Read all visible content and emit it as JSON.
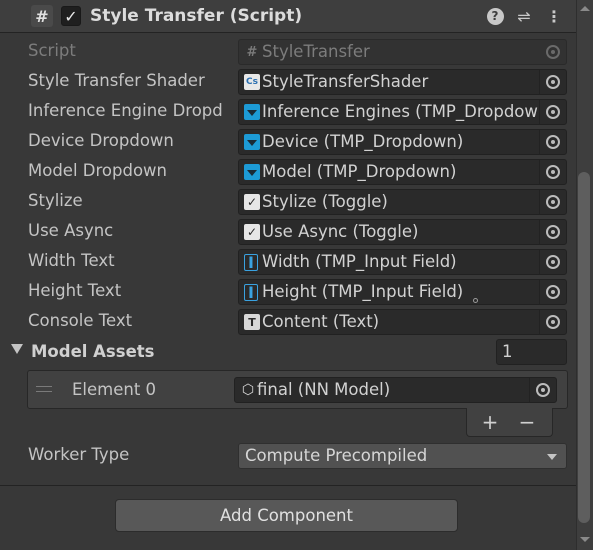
{
  "header": {
    "title": "Style Transfer (Script)",
    "enabled": true,
    "component_icon": "hash-script-icon",
    "buttons": [
      "help-icon",
      "presets-icon",
      "more-icon"
    ]
  },
  "fields": [
    {
      "label": "Script",
      "value": "StyleTransfer",
      "icon": "script-icon",
      "disabled": true
    },
    {
      "label": "Style Transfer Shader",
      "value": "StyleTransferShader",
      "icon": "compute-shader-icon",
      "icon_text": "Cs"
    },
    {
      "label": "Inference Engine Dropd",
      "value": "Inference Engines (TMP_Dropdown)",
      "icon": "dropdown-icon"
    },
    {
      "label": "Device Dropdown",
      "value": "Device (TMP_Dropdown)",
      "icon": "dropdown-icon"
    },
    {
      "label": "Model Dropdown",
      "value": "Model (TMP_Dropdown)",
      "icon": "dropdown-icon"
    },
    {
      "label": "Stylize",
      "value": "Stylize (Toggle)",
      "icon": "toggle-icon"
    },
    {
      "label": "Use Async",
      "value": "Use Async (Toggle)",
      "icon": "toggle-icon"
    },
    {
      "label": "Width Text",
      "value": "Width (TMP_Input Field)",
      "icon": "input-field-icon"
    },
    {
      "label": "Height Text",
      "value": "Height (TMP_Input Field)",
      "icon": "input-field-icon"
    },
    {
      "label": "Console Text",
      "value": "Content (Text)",
      "icon": "text-icon",
      "icon_text": "T"
    }
  ],
  "model_assets": {
    "label": "Model Assets",
    "count": "1",
    "elements": [
      {
        "label": "Element 0",
        "value": "final (NN Model)",
        "icon": "nn-model-icon"
      }
    ],
    "add_symbol": "+",
    "remove_symbol": "−"
  },
  "worker_type": {
    "label": "Worker Type",
    "value": "Compute Precompiled"
  },
  "add_component_label": "Add Component",
  "colors": {
    "background": "#383838",
    "field_bg": "#2a2a2a",
    "dropdown_icon": "#1d9bd6",
    "input_icon": "#3aa2e0"
  }
}
